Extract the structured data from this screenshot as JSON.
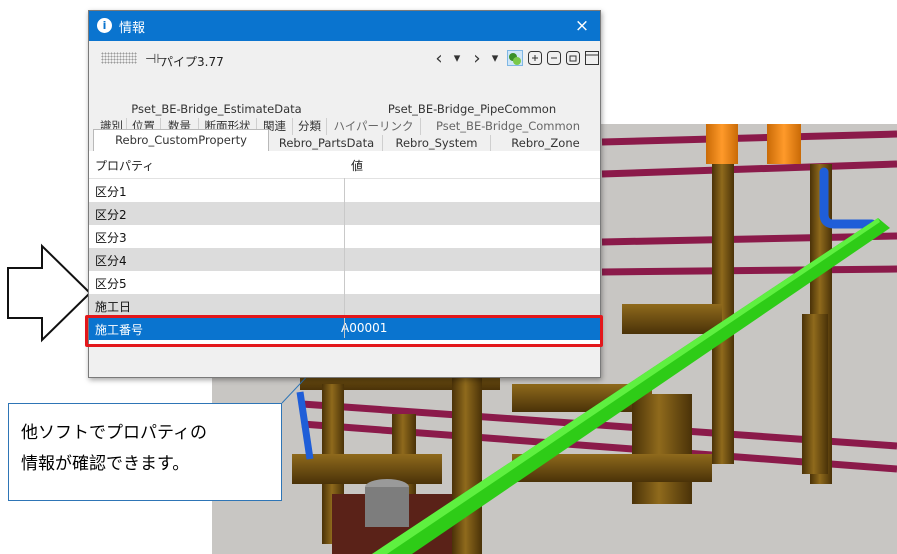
{
  "dialog": {
    "title": "情報",
    "close_label": "×",
    "toolbar": {
      "element_name": "パイプ3.77",
      "prev_label": "‹",
      "next_label": "›",
      "dropdown_label": "▾"
    },
    "tabs_row1": [
      "Pset_BE-Bridge_EstimateData",
      "Pset_BE-Bridge_PipeCommon"
    ],
    "tabs_row2": [
      "識別",
      "位置",
      "数量",
      "断面形状",
      "関連",
      "分類",
      "ハイパーリンク",
      "Pset_BE-Bridge_Common"
    ],
    "tabs_row3": [
      "Rebro_CustomProperty",
      "Rebro_PartsData",
      "Rebro_System",
      "Rebro_Zone"
    ],
    "grid": {
      "col_property": "プロパティ",
      "col_value": "値",
      "rows": [
        {
          "property": "区分1",
          "value": ""
        },
        {
          "property": "区分2",
          "value": ""
        },
        {
          "property": "区分3",
          "value": ""
        },
        {
          "property": "区分4",
          "value": ""
        },
        {
          "property": "区分5",
          "value": ""
        },
        {
          "property": "施工日",
          "value": ""
        },
        {
          "property": "施工番号",
          "value": "A00001"
        }
      ]
    }
  },
  "callout": {
    "line1": "他ソフトでプロパティの",
    "line2": "情報が確認できます。"
  },
  "colors": {
    "accent": "#0a74cf",
    "highlight": "#e3171b",
    "pipe_green": "#2ecc17",
    "pipe_brown": "#7a5a12",
    "pipe_orange": "#f08a14"
  }
}
